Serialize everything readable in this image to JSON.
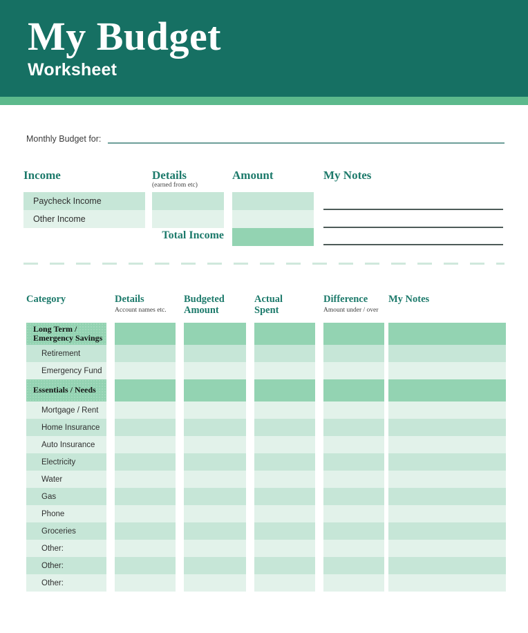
{
  "header": {
    "title": "My Budget",
    "subtitle": "Worksheet",
    "bg_color": "#167063",
    "accent_color": "#5cb98c"
  },
  "monthly": {
    "label": "Monthly Budget for:",
    "value": ""
  },
  "income": {
    "headers": {
      "income": "Income",
      "details": "Details",
      "details_sub": "(earned from etc)",
      "amount": "Amount",
      "notes": "My Notes"
    },
    "rows": [
      {
        "label": "Paycheck Income",
        "details": "",
        "amount": ""
      },
      {
        "label": "Other Income",
        "details": "",
        "amount": ""
      }
    ],
    "total_label": "Total Income",
    "total_amount": "",
    "note_lines": [
      "",
      "",
      ""
    ]
  },
  "table": {
    "headers": {
      "category": "Category",
      "details": "Details",
      "details_sub": "Account names etc.",
      "budgeted": "Budgeted\nAmount",
      "budgeted_line1": "Budgeted",
      "budgeted_line2": "Amount",
      "actual": "Actual\nSpent",
      "actual_line1": "Actual",
      "actual_line2": "Spent",
      "difference": "Difference",
      "difference_sub": "Amount under / over",
      "notes": "My Notes"
    },
    "rows": [
      {
        "type": "section",
        "label": "Long Term /\nEmergency Savings",
        "line1": "Long Term /",
        "line2": "Emergency Savings",
        "shade": "dark"
      },
      {
        "type": "item",
        "label": "Retirement",
        "shade": "mid"
      },
      {
        "type": "item",
        "label": "Emergency Fund",
        "shade": "light"
      },
      {
        "type": "section",
        "label": "Essentials / Needs",
        "line1": "Essentials / Needs",
        "line2": "",
        "shade": "dark"
      },
      {
        "type": "item",
        "label": "Mortgage / Rent",
        "shade": "light"
      },
      {
        "type": "item",
        "label": "Home Insurance",
        "shade": "mid"
      },
      {
        "type": "item",
        "label": "Auto Insurance",
        "shade": "light"
      },
      {
        "type": "item",
        "label": "Electricity",
        "shade": "mid"
      },
      {
        "type": "item",
        "label": "Water",
        "shade": "light"
      },
      {
        "type": "item",
        "label": "Gas",
        "shade": "mid"
      },
      {
        "type": "item",
        "label": "Phone",
        "shade": "light"
      },
      {
        "type": "item",
        "label": "Groceries",
        "shade": "mid"
      },
      {
        "type": "item",
        "label": "Other:",
        "shade": "light"
      },
      {
        "type": "item",
        "label": "Other:",
        "shade": "mid"
      },
      {
        "type": "item",
        "label": "Other:",
        "shade": "light"
      }
    ]
  },
  "colors": {
    "teal": "#1d7a6b",
    "fill_dark": "#93d3b2",
    "fill_mid": "#c6e6d7",
    "fill_light": "#e2f2ea",
    "rule": "#6d9e99",
    "note_line": "#4d5b58",
    "dash": "#cfe8dc"
  }
}
